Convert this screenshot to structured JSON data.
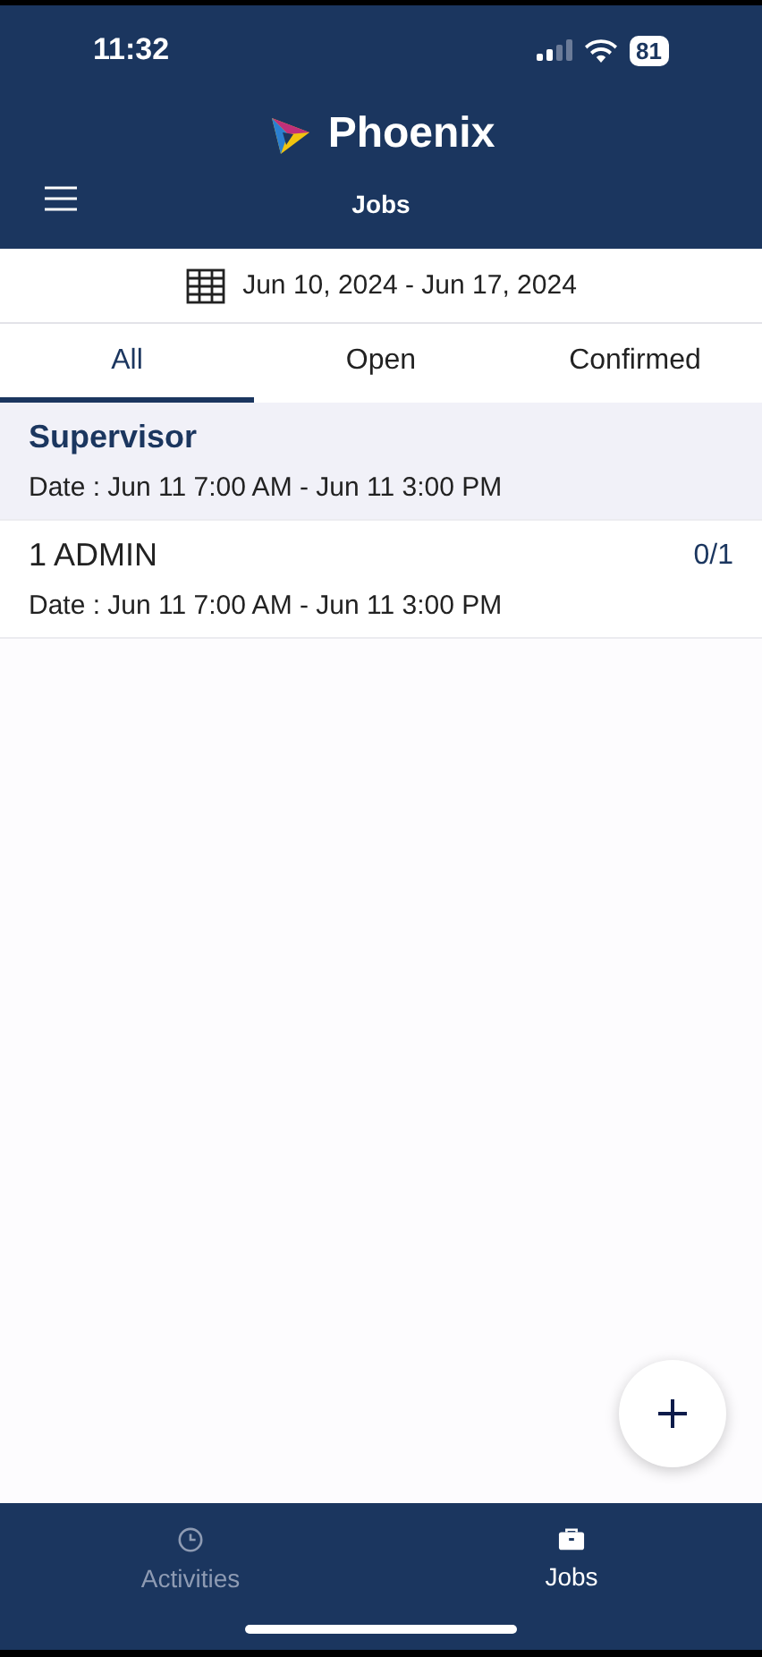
{
  "status_bar": {
    "time": "11:32",
    "battery": "81"
  },
  "header": {
    "brand": "Phoenix",
    "title": "Jobs"
  },
  "date_range": "Jun 10, 2024 - Jun 17, 2024",
  "tabs": [
    {
      "label": "All",
      "selected": true
    },
    {
      "label": "Open",
      "selected": false
    },
    {
      "label": "Confirmed",
      "selected": false
    }
  ],
  "jobs": [
    {
      "name": "Supervisor",
      "date": "Date : Jun 11 7:00 AM - Jun 11 3:00 PM",
      "selected": true
    },
    {
      "name": "1 ADMIN",
      "count": "0/1",
      "date": "Date : Jun 11 7:00 AM - Jun 11 3:00 PM",
      "selected": false
    }
  ],
  "bottom_nav": [
    {
      "label": "Activities",
      "selected": false
    },
    {
      "label": "Jobs",
      "selected": true
    }
  ]
}
